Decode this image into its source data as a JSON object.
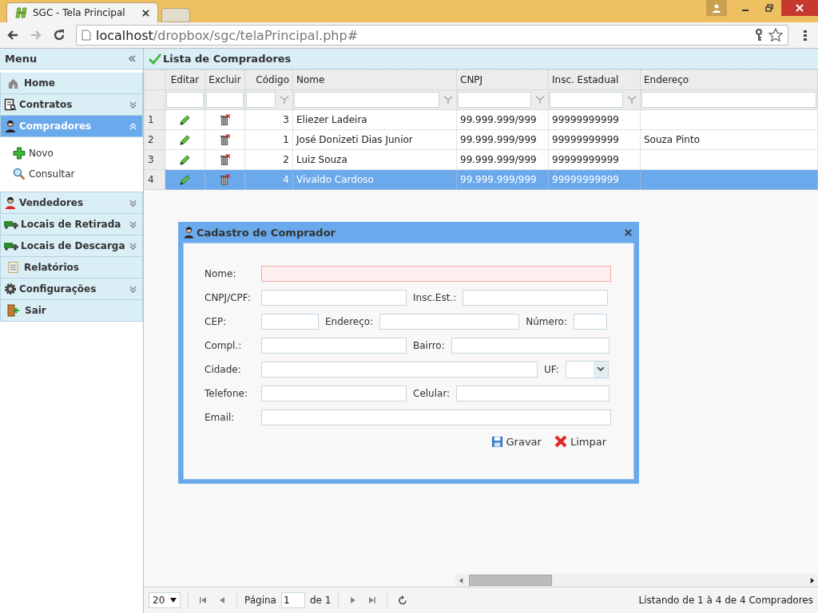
{
  "browser": {
    "tab_title": "SGC - Tela Principal",
    "url_host": "localhost",
    "url_path": "/dropbox/sgc/telaPrincipal.php#"
  },
  "menu": {
    "title": "Menu",
    "items": [
      {
        "label": "Home",
        "kind": "link",
        "selected": false
      },
      {
        "label": "Contratos",
        "kind": "group",
        "selected": false,
        "expanded": false
      },
      {
        "label": "Compradores",
        "kind": "group",
        "selected": true,
        "expanded": true,
        "children": [
          {
            "label": "Novo"
          },
          {
            "label": "Consultar"
          }
        ]
      },
      {
        "label": "Vendedores",
        "kind": "group",
        "selected": false,
        "expanded": false
      },
      {
        "label": "Locais de Retirada",
        "kind": "group",
        "selected": false,
        "expanded": false
      },
      {
        "label": "Locais de Descarga",
        "kind": "group",
        "selected": false,
        "expanded": false
      },
      {
        "label": "Relatórios",
        "kind": "link",
        "selected": false
      },
      {
        "label": "Configurações",
        "kind": "group",
        "selected": false,
        "expanded": false
      },
      {
        "label": "Sair",
        "kind": "link",
        "selected": false
      }
    ]
  },
  "panel": {
    "title": "Lista de Compradores"
  },
  "table": {
    "columns": [
      {
        "label": "Editar"
      },
      {
        "label": "Excluir"
      },
      {
        "label": "Código"
      },
      {
        "label": "Nome"
      },
      {
        "label": "CNPJ"
      },
      {
        "label": "Insc. Estadual"
      },
      {
        "label": "Endereço"
      }
    ],
    "rows": [
      {
        "number": "1",
        "codigo": "3",
        "nome": "Eliezer Ladeira",
        "cnpj": "99.999.999/999",
        "insc": "99999999999",
        "endereco": "",
        "selected": false
      },
      {
        "number": "2",
        "codigo": "1",
        "nome": "José Donizeti Dias Junior",
        "cnpj": "99.999.999/999",
        "insc": "99999999999",
        "endereco": "Souza Pinto",
        "selected": false
      },
      {
        "number": "3",
        "codigo": "2",
        "nome": "Luiz Souza",
        "cnpj": "99.999.999/999",
        "insc": "99999999999",
        "endereco": "",
        "selected": false
      },
      {
        "number": "4",
        "codigo": "4",
        "nome": "Vivaldo Cardoso",
        "cnpj": "99.999.999/999",
        "insc": "99999999999",
        "endereco": "",
        "selected": true
      }
    ]
  },
  "pager": {
    "page_size": "20",
    "page_label": "Página",
    "page": "1",
    "of_label": "de 1",
    "summary": "Listando de 1 à 4 de 4 Compradores"
  },
  "dialog": {
    "title": "Cadastro de Comprador",
    "rows": [
      {
        "fields": [
          {
            "label": "Nome:",
            "kind": "text",
            "invalid": true
          }
        ]
      },
      {
        "fields": [
          {
            "label": "CNPJ/CPF:",
            "kind": "text",
            "invalid": false
          },
          {
            "label": "Insc.Est.:",
            "kind": "text",
            "invalid": false
          }
        ]
      },
      {
        "fields": [
          {
            "label": "CEP:",
            "kind": "text",
            "invalid": false
          },
          {
            "label": "Endereço:",
            "kind": "text",
            "invalid": false
          },
          {
            "label": "Número:",
            "kind": "text",
            "invalid": false
          }
        ]
      },
      {
        "fields": [
          {
            "label": "Compl.:",
            "kind": "text",
            "invalid": false
          },
          {
            "label": "Bairro:",
            "kind": "text",
            "invalid": false
          }
        ]
      },
      {
        "fields": [
          {
            "label": "Cidade:",
            "kind": "text",
            "invalid": false
          },
          {
            "label": "UF:",
            "kind": "select",
            "invalid": false
          }
        ]
      },
      {
        "fields": [
          {
            "label": "Telefone:",
            "kind": "text",
            "invalid": false
          },
          {
            "label": "Celular:",
            "kind": "text",
            "invalid": false
          }
        ]
      },
      {
        "fields": [
          {
            "label": "Email:",
            "kind": "text",
            "invalid": false
          }
        ]
      }
    ],
    "buttons": [
      {
        "label": "Gravar",
        "kind": "save"
      },
      {
        "label": "Limpar",
        "kind": "clear"
      }
    ]
  }
}
